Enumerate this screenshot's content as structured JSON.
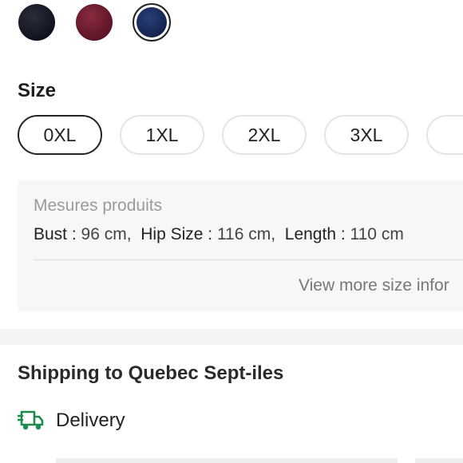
{
  "colors": {
    "swatches": [
      {
        "name": "black",
        "hex": "#1a1c2a",
        "selected": false
      },
      {
        "name": "burgundy",
        "hex": "#6e1d30",
        "selected": false
      },
      {
        "name": "navy",
        "hex": "#1e2f63",
        "selected": true
      }
    ],
    "accent_green": "#1f8a4c"
  },
  "size": {
    "title": "Size",
    "options": [
      {
        "label": "0XL",
        "selected": true
      },
      {
        "label": "1XL",
        "selected": false
      },
      {
        "label": "2XL",
        "selected": false
      },
      {
        "label": "3XL",
        "selected": false
      }
    ]
  },
  "measurements": {
    "title": "Mesures produits",
    "bust_label": "Bust : ",
    "bust_value": "96 cm,",
    "hip_label": "Hip Size : ",
    "hip_value": "116 cm,",
    "length_label": "Length : ",
    "length_value": "110 cm",
    "view_more": "View more size infor"
  },
  "shipping": {
    "title": "Shipping to Quebec Sept-iles",
    "delivery_label": "Delivery",
    "delivery_icon": "truck-icon"
  }
}
